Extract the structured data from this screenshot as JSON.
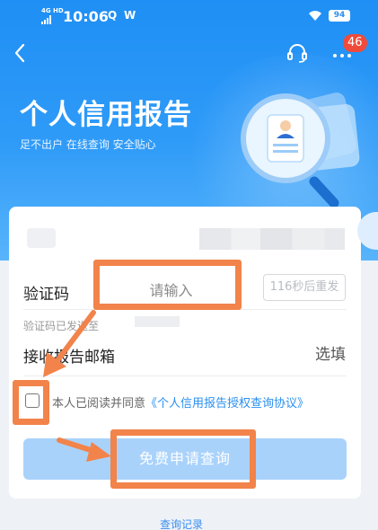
{
  "status_bar": {
    "network": "4G HD",
    "time": "10:06",
    "app_icons": [
      "Q",
      "W"
    ],
    "battery": "94"
  },
  "header": {
    "back_icon": "chevron-left-icon",
    "headset_icon": "headset-icon",
    "more_icon": "more-icon",
    "badge_count": "46"
  },
  "hero": {
    "title": "个人信用报告",
    "subtitle": "足不出户 在线查询 安全贴心"
  },
  "form": {
    "code_label": "验证码",
    "code_placeholder": "请输入",
    "resend_label": "116秒后重发",
    "code_hint": "验证码已发送至",
    "email_label": "接收报告邮箱",
    "email_placeholder": "选填",
    "agree_prefix": "本人已阅读并同意",
    "agree_link": "《个人信用报告授权查询协议》",
    "submit_label": "免费申请查询"
  },
  "footer": {
    "records_link": "查询记录"
  },
  "colors": {
    "primary": "#2a8ff0",
    "hero_gradient_top": "#1f8ff5",
    "submit_disabled": "#a9d2fb",
    "annotation": "#f2834a",
    "badge": "#f04b3a"
  }
}
